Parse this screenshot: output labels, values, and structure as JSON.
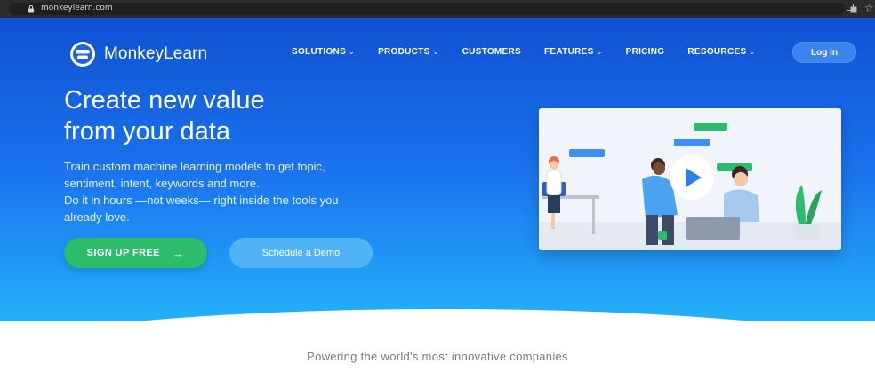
{
  "browser": {
    "url": "monkeylearn.com",
    "icons": [
      "lock-icon",
      "translate-icon",
      "star-icon"
    ]
  },
  "brand": {
    "name": "MonkeyLearn",
    "icon": "monkey-face-icon"
  },
  "nav": {
    "items": [
      {
        "label": "SOLUTIONS",
        "has_dropdown": true
      },
      {
        "label": "PRODUCTS",
        "has_dropdown": true
      },
      {
        "label": "CUSTOMERS",
        "has_dropdown": false
      },
      {
        "label": "FEATURES",
        "has_dropdown": true
      },
      {
        "label": "PRICING",
        "has_dropdown": false
      },
      {
        "label": "RESOURCES",
        "has_dropdown": true
      }
    ],
    "login_label": "Log in"
  },
  "hero": {
    "headline_line1": "Create new value",
    "headline_line2": "from your data",
    "subcopy_line1": "Train custom machine learning models to get topic,",
    "subcopy_line2": "sentiment, intent, keywords and more.",
    "subcopy_line3": "Do it in hours —not weeks— right inside the tools you",
    "subcopy_line4": "already love.",
    "signup_label": "SIGN UP FREE",
    "signup_arrow": "→",
    "demo_label": "Schedule a Demo",
    "video_icon": "play-icon"
  },
  "powering_text": "Powering the world's most innovative companies",
  "colors": {
    "hero_top": "#0f52d3",
    "hero_bottom": "#23b1f9",
    "signup_green": "#2dbb6c",
    "demo_blue": "#4fb3f6"
  }
}
